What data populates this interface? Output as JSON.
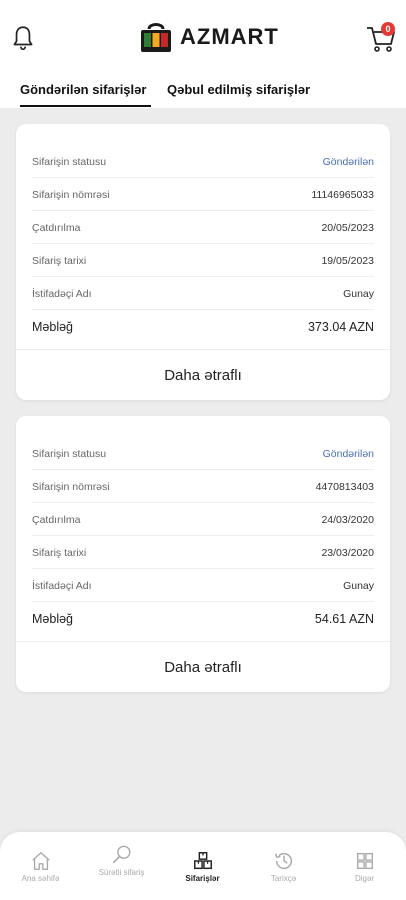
{
  "header": {
    "brand": "AZMART",
    "cart_count": "0"
  },
  "tabs": [
    {
      "label": "Göndərilən sifarişlər",
      "active": true
    },
    {
      "label": "Qəbul edilmiş sifarişlər",
      "active": false
    }
  ],
  "orders": [
    {
      "status_label": "Sifarişin statusu",
      "status_value": "Göndərilən",
      "number_label": "Sifarişin nömrəsi",
      "number_value": "11146965033",
      "delivery_label": "Çatdırılma",
      "delivery_value": "20/05/2023",
      "date_label": "Sifariş tarixi",
      "date_value": "19/05/2023",
      "user_label": "İstifadəçi Adı",
      "user_value": "Gunay",
      "amount_label": "Məbləğ",
      "amount_value": "373.04 AZN",
      "more_label": "Daha ətraflı"
    },
    {
      "status_label": "Sifarişin statusu",
      "status_value": "Göndərilən",
      "number_label": "Sifarişin nömrəsi",
      "number_value": "4470813403",
      "delivery_label": "Çatdırılma",
      "delivery_value": "24/03/2020",
      "date_label": "Sifariş tarixi",
      "date_value": "23/03/2020",
      "user_label": "İstifadəçi Adı",
      "user_value": "Gunay",
      "amount_label": "Məbləğ",
      "amount_value": "54.61 AZN",
      "more_label": "Daha ətraflı"
    }
  ],
  "bottom_nav": [
    {
      "label": "Ana səhifə",
      "icon": "home-icon",
      "active": false
    },
    {
      "label": "Sürətli sifariş",
      "icon": "search-icon",
      "active": false
    },
    {
      "label": "Sifarişlər",
      "icon": "orders-icon",
      "active": true
    },
    {
      "label": "Tarixçə",
      "icon": "history-icon",
      "active": false
    },
    {
      "label": "Digər",
      "icon": "grid-icon",
      "active": false
    }
  ],
  "colors": {
    "accent": "#4a6fb8",
    "badge": "#e53935",
    "logo_green": "#2e7d32",
    "logo_red": "#c62828",
    "logo_yellow": "#f9a825"
  }
}
